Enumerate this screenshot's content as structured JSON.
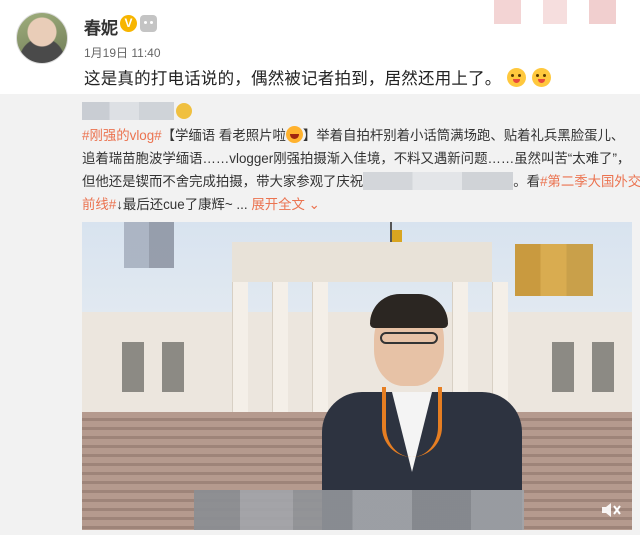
{
  "post": {
    "username": "春妮",
    "verified_badge": "V",
    "timestamp": "1月19日 11:40",
    "text": "这是真的打电话说的，偶然被记者拍到，居然还用上了。"
  },
  "repost": {
    "hashtag_vlog": "#刚强的vlog#",
    "line1_a": "【学缅语 看老照片啦",
    "line1_b": "】举着自拍杆别着小话筒满场跑、贴着礼兵黑脸蛋儿、",
    "line2": "追着瑞苗胞波学缅语……vlogger刚强拍摄渐入佳境，不料又遇新问题……虽然叫苦“太难了”，",
    "line3_a": "但他还是锲而不舍完成拍摄，带大家参观了庆祝",
    "line3_b": "。看",
    "hashtag_series_a": "#第二季大国外交最",
    "hashtag_series_b": "前线#",
    "line4_b": "↓最后还cue了康辉~ ...",
    "expand_link": "展开全文",
    "expand_chevron": "⌄"
  },
  "icons": {
    "verified": "verified-v-icon",
    "member": "member-robot-icon",
    "mute": "mute-icon"
  },
  "colors": {
    "accent": "#eb7350",
    "repost_bg": "#f2f2f2",
    "verified": "#f7b500"
  }
}
